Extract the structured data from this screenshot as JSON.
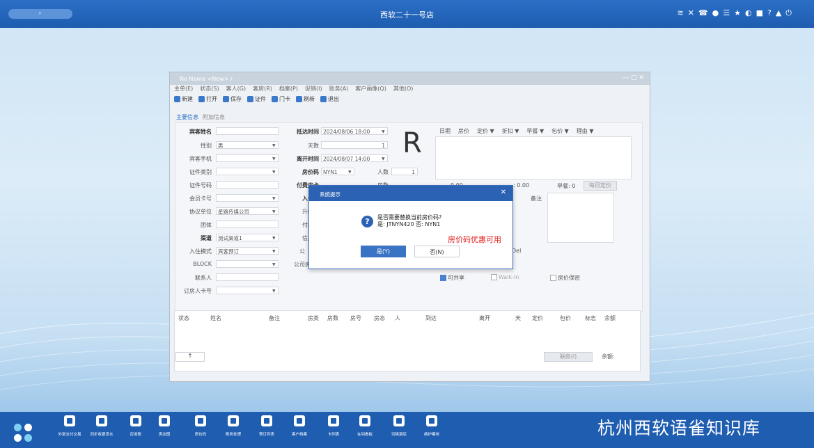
{
  "top_bar": {
    "title": "西软二十一号店",
    "icons": [
      "wifi-icon",
      "tools-icon",
      "phone-icon",
      "pin-icon",
      "list-icon",
      "star-icon",
      "moon-icon",
      "mail-icon",
      "help-icon",
      "bell-icon",
      "power-icon"
    ]
  },
  "window": {
    "title": "No Name <New> /",
    "menu": [
      "主单(E)",
      "状态(S)",
      "客人(G)",
      "客房(R)",
      "档案(P)",
      "促销(I)",
      "账务(A)",
      "客户画像(Q)",
      "其他(O)"
    ],
    "toolbar": [
      "新建",
      "打开",
      "保存",
      "证件",
      "门卡",
      "刷新",
      "退出"
    ],
    "tabs": [
      "主要信息",
      "附加信息"
    ],
    "form": {
      "guest_name_label": "宾客姓名",
      "gender_label": "性别",
      "gender_value": "男",
      "phone_label": "宾客手机",
      "id_type_label": "证件类别",
      "id_no_label": "证件号码",
      "member_label": "会员卡号",
      "agreement_label": "协议单位",
      "agreement_value": "星路传媒公司",
      "group_label": "团体",
      "channel_label": "渠道",
      "channel_value": "测试渠道1",
      "checkin_mode_label": "入住模式",
      "checkin_mode_value": "宾客预订",
      "block_label": "BLOCK",
      "contact_label": "联系人",
      "booker_card_label": "订房人卡号",
      "arrival_label": "抵达时间",
      "arrival_value": "2024/08/06 18:00",
      "days_label": "天数",
      "days_value": "1",
      "departure_label": "离开时间",
      "departure_value": "2024/08/07 14:00",
      "rate_code_label": "房价码",
      "rate_code_value": "NYN1",
      "persons_label": "人数",
      "persons_value": "1",
      "pay_label": "付费房卡",
      "room_count_label": "房数",
      "checkin_room_label": "入住房",
      "upgrade_label": "升级理",
      "pay_method_label": "付款方",
      "credit_label": "信用限",
      "gong_label": "公",
      "company_deposit_label": "公司佣",
      "big_status": "R"
    },
    "rate_columns": [
      "日期",
      "房价",
      "定价 ▼",
      "折扣 ▼",
      "早餐 ▼",
      "包价 ▼",
      "理由 ▼"
    ],
    "rate_summary": {
      "amount1": "0.00",
      "amount2": ": 0.00",
      "breakfast": "早餐: 0",
      "daily_btn": "每日定价"
    },
    "remark_label": "备注",
    "checkboxes": [
      {
        "label": "可共享",
        "checked": true
      },
      {
        "label": "Walk-In",
        "checked": false
      },
      {
        "label": "房价保密",
        "checked": false
      }
    ],
    "del_text": "Del",
    "grid_columns": [
      "状态",
      "姓名",
      "备注",
      "房类",
      "房数",
      "房号",
      "房态",
      "人",
      "到达",
      "离开",
      "天",
      "定价",
      "包价",
      "标志",
      "余额"
    ],
    "footer": {
      "up_arrow": "↑",
      "joint_btn": "联房(I)",
      "balance": "余额:"
    }
  },
  "dialog": {
    "title": "系统提示",
    "message_line1": "是否需要替换当前房价码?",
    "message_line2": "是: JTNYN420 否: NYN1",
    "yes_label": "是(Y)",
    "no_label": "否(N)"
  },
  "tip_text": "房价码优惠可用",
  "taskbar": {
    "items": [
      "外部支付交易",
      "同步收银流水",
      "应收账",
      "房态图",
      "房价码",
      "账务处理",
      "预订列表",
      "客户档案",
      "卡列表",
      "在间看板",
      "切换酒店",
      "维护模块"
    ],
    "watermark": "杭州西软语雀知识库"
  }
}
